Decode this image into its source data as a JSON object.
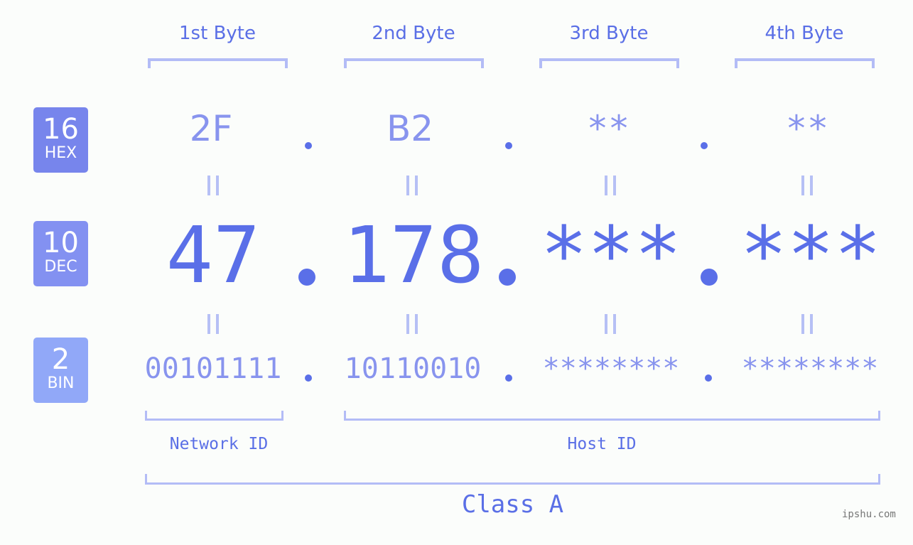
{
  "bytes": {
    "headers": [
      "1st Byte",
      "2nd Byte",
      "3rd Byte",
      "4th Byte"
    ]
  },
  "badges": {
    "hex": {
      "number": "16",
      "label": "HEX",
      "color": "#7785ec"
    },
    "dec": {
      "number": "10",
      "label": "DEC",
      "color": "#8391f1"
    },
    "bin": {
      "number": "2",
      "label": "BIN",
      "color": "#91a8f8"
    }
  },
  "hex_values": [
    "2F",
    "B2",
    "**",
    "**"
  ],
  "dec_values": [
    "47",
    "178",
    "***",
    "***"
  ],
  "bin_values": [
    "00101111",
    "10110010",
    "********",
    "********"
  ],
  "separator": ".",
  "id_labels": {
    "network": "Network ID",
    "host": "Host ID"
  },
  "class_label": "Class A",
  "watermark": "ipshu.com",
  "colors": {
    "accent": "#5a6fe8",
    "muted_value": "#8894ee",
    "bracket": "#b3bcf6",
    "background": "#fbfdfb"
  }
}
